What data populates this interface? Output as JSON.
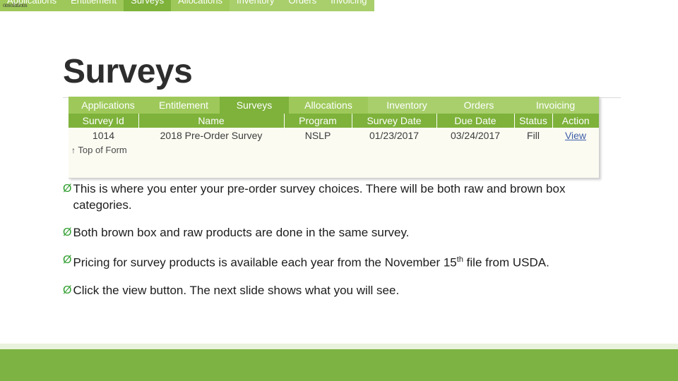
{
  "slide": {
    "title": "Surveys",
    "logo_text": "onsolutions"
  },
  "top_nav": {
    "items": [
      {
        "label": "Applications",
        "active": false
      },
      {
        "label": "Entitlement",
        "active": false
      },
      {
        "label": "Surveys",
        "active": true
      },
      {
        "label": "Allocations",
        "active": false
      },
      {
        "label": "Inventory",
        "active": false
      },
      {
        "label": "Orders",
        "active": false
      },
      {
        "label": "Invoicing",
        "active": false
      }
    ]
  },
  "screenshot": {
    "nav": {
      "items": [
        {
          "label": "Applications",
          "active": false
        },
        {
          "label": "Entitlement",
          "active": false
        },
        {
          "label": "Surveys",
          "active": true
        },
        {
          "label": "Allocations",
          "active": false
        },
        {
          "label": "Inventory",
          "active": false
        },
        {
          "label": "Orders",
          "active": false
        },
        {
          "label": "Invoicing",
          "active": false
        }
      ]
    },
    "table": {
      "headers": [
        "Survey Id",
        "Name",
        "Program",
        "Survey Date",
        "Due Date",
        "Status",
        "Action"
      ],
      "rows": [
        {
          "survey_id": "1014",
          "name": "2018 Pre-Order Survey",
          "program": "NSLP",
          "survey_date": "01/23/2017",
          "due_date": "03/24/2017",
          "status": "Fill",
          "action": "View"
        }
      ]
    },
    "top_of_form": "Top of Form",
    "top_of_form_arrow": "↑"
  },
  "bullets": [
    {
      "marker": "Ø",
      "pre": "This is where you enter your pre-order survey choices. There will be both raw and brown box categories.",
      "sup": "",
      "post": ""
    },
    {
      "marker": "Ø",
      "pre": "Both brown box and raw products are done in the same survey.",
      "sup": "",
      "post": ""
    },
    {
      "marker": "Ø",
      "pre": "Pricing for survey products is available each year from the November 15",
      "sup": "th",
      "post": " file from USDA."
    },
    {
      "marker": "Ø",
      "pre": "Click the view button. The next slide shows what you will see.",
      "sup": "",
      "post": ""
    }
  ],
  "colors": {
    "accent_green": "#7cb342",
    "nav_green": "#9ec95a",
    "nav_active": "#7eb23b",
    "link_blue": "#3e5fa8"
  }
}
